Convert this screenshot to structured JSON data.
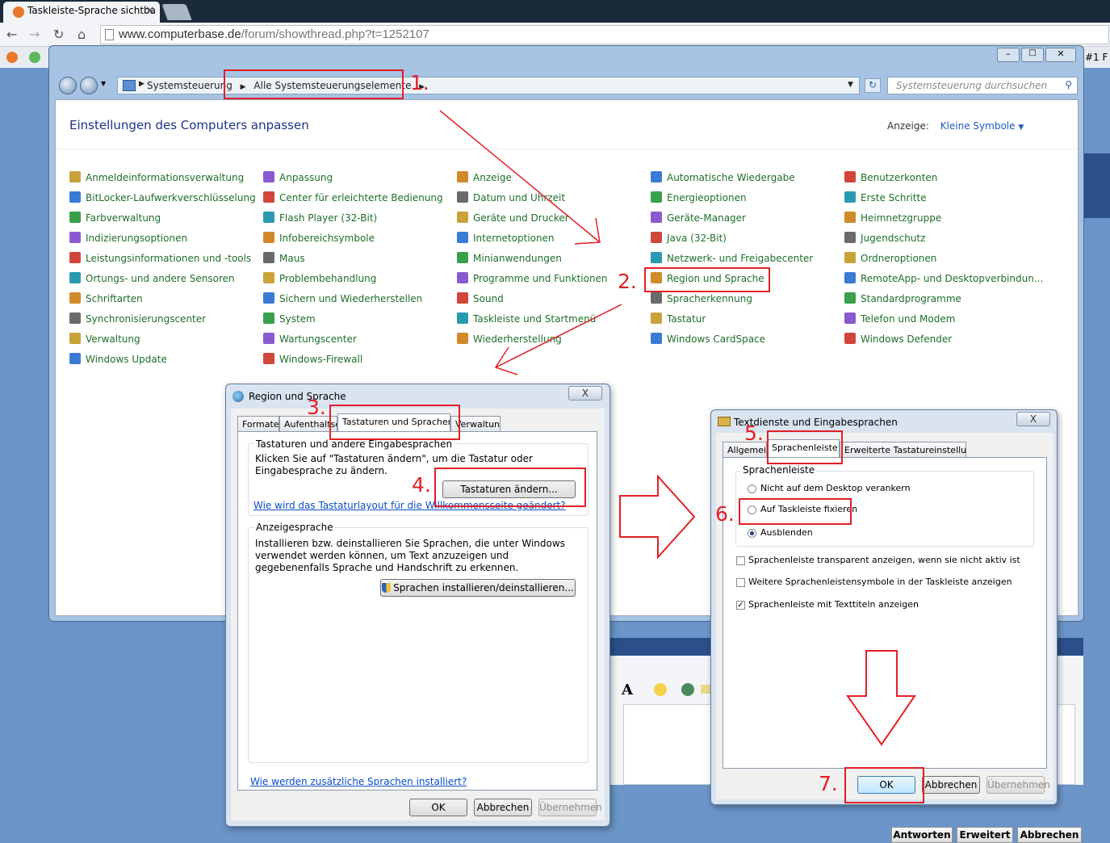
{
  "browser": {
    "tab_title": "Taskleiste-Sprache sichtba",
    "tab_close": "×",
    "url_host": "www.computerbase.de",
    "url_path": "/forum/showthread.php?t=1252107",
    "right_clip": "#1 F"
  },
  "control_panel": {
    "breadcrumb_root": "Systemsteuerung",
    "breadcrumb_current": "Alle Systemsteuerungselemente",
    "search_placeholder": "Systemsteuerung durchsuchen",
    "title": "Einstellungen des Computers anpassen",
    "view_label": "Anzeige:",
    "view_value": "Kleine Symbole",
    "columns": [
      [
        "Anmeldeinformationsverwaltung",
        "BitLocker-Laufwerkverschlüsselung",
        "Farbverwaltung",
        "Indizierungsoptionen",
        "Leistungsinformationen und -tools",
        "Ortungs- und andere Sensoren",
        "Schriftarten",
        "Synchronisierungscenter",
        "Verwaltung",
        "Windows Update"
      ],
      [
        "Anpassung",
        "Center für erleichterte Bedienung",
        "Flash Player (32-Bit)",
        "Infobereichsymbole",
        "Maus",
        "Problembehandlung",
        "Sichern und Wiederherstellen",
        "System",
        "Wartungscenter",
        "Windows-Firewall"
      ],
      [
        "Anzeige",
        "Datum und Uhrzeit",
        "Geräte und Drucker",
        "Internetoptionen",
        "Minianwendungen",
        "Programme und Funktionen",
        "Sound",
        "Taskleiste und Startmenü",
        "Wiederherstellung"
      ],
      [
        "Automatische Wiedergabe",
        "Energieoptionen",
        "Geräte-Manager",
        "Java (32-Bit)",
        "Netzwerk- und Freigabecenter",
        "Region und Sprache",
        "Spracherkennung",
        "Tastatur",
        "Windows CardSpace"
      ],
      [
        "Benutzerkonten",
        "Erste Schritte",
        "Heimnetzgruppe",
        "Jugendschutz",
        "Ordneroptionen",
        "RemoteApp- und Desktopverbindun...",
        "Standardprogramme",
        "Telefon und Modem",
        "Windows Defender"
      ]
    ]
  },
  "region_dialog": {
    "title": "Region und Sprache",
    "close": "X",
    "tabs": [
      "Formate",
      "Aufenthaltsort",
      "Tastaturen und Sprachen",
      "Verwaltung"
    ],
    "group1_label": "Tastaturen und andere Eingabesprachen",
    "group1_text": "Klicken Sie auf \"Tastaturen ändern\", um die Tastatur oder Eingabesprache zu ändern.",
    "change_keyboards": "Tastaturen ändern...",
    "welcome_link": "Wie wird das Tastaturlayout für die Willkommensseite geändert?",
    "group2_label": "Anzeigesprache",
    "group2_text": "Installieren bzw. deinstallieren Sie Sprachen, die unter Windows verwendet werden können, um Text anzuzeigen und gegebenenfalls Sprache und Handschrift zu erkennen.",
    "install_languages": "Sprachen installieren/deinstallieren...",
    "more_link": "Wie werden zusätzliche Sprachen installiert?",
    "ok": "OK",
    "cancel": "Abbrechen",
    "apply": "Übernehmen"
  },
  "text_services_dialog": {
    "title": "Textdienste und Eingabesprachen",
    "close": "X",
    "tabs": [
      "Allgemein",
      "Sprachenleiste",
      "Erweiterte Tastatureinstellungen"
    ],
    "group_label": "Sprachenleiste",
    "radio_options": [
      "Nicht auf dem Desktop verankern",
      "Auf Taskleiste fixieren",
      "Ausblenden"
    ],
    "checkboxes": [
      "Sprachenleiste transparent anzeigen, wenn sie nicht aktiv ist",
      "Weitere Sprachenleistensymbole in der Taskleiste anzeigen",
      "Sprachenleiste mit Texttiteln anzeigen"
    ],
    "ok": "OK",
    "cancel": "Abbrechen",
    "apply": "Übernehmen"
  },
  "annotations": {
    "step1": "1.",
    "step2": "2.",
    "step3": "3.",
    "step4": "4.",
    "step5": "5.",
    "step6": "6.",
    "step7": "7.",
    "color": "#e21f26"
  },
  "forum": {
    "font_btn": "A",
    "reply": "Antworten",
    "advanced": "Erweitert",
    "cancel": "Abbrechen"
  }
}
